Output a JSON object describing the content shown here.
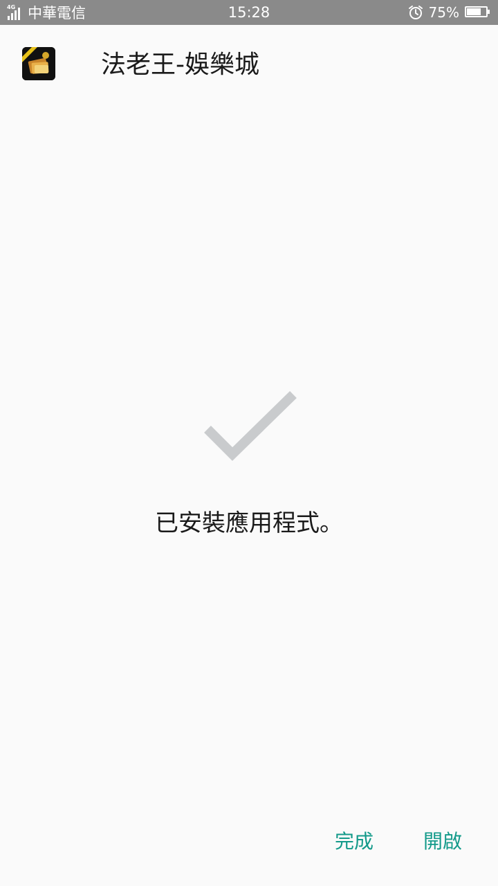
{
  "status_bar": {
    "network_type": "4G",
    "carrier": "中華電信",
    "time": "15:28",
    "battery_percent_label": "75%",
    "battery_level": 0.75,
    "icons": [
      "signal-icon",
      "alarm-icon",
      "battery-icon"
    ]
  },
  "header": {
    "app_name": "法老王-娛樂城",
    "app_icon": "app-icon"
  },
  "main": {
    "status_icon": "check-icon",
    "message": "已安裝應用程式。"
  },
  "actions": {
    "done_label": "完成",
    "open_label": "開啟"
  },
  "colors": {
    "status_bar_bg": "#8a8a8a",
    "page_bg": "#fafafa",
    "accent": "#139a8a",
    "check": "#c9cbcd"
  }
}
